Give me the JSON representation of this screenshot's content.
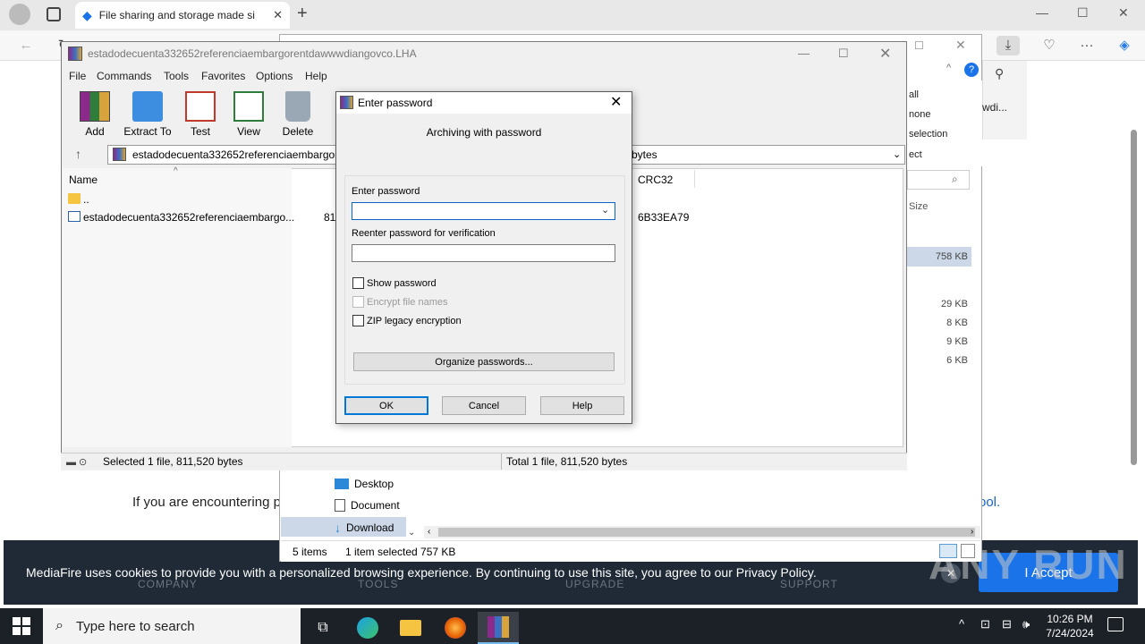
{
  "browser": {
    "tab_title": "File sharing and storage made si",
    "tab_close": "✕",
    "new_tab": "+",
    "min": "—",
    "max": "☐",
    "close": "✕",
    "more": "···"
  },
  "page": {
    "text_partial": "If you are encountering p",
    "link_partial": "ool.",
    "cookie_text": "MediaFire uses cookies to provide you with a personalized browsing experience. By continuing to use this site, you agree to our Privacy Policy.",
    "accept_label": "I Accept",
    "cookie_close": "✕",
    "footer_nav": [
      "COMPANY",
      "TOOLS",
      "UPGRADE",
      "SUPPORT"
    ],
    "watermark": "ANY RUN"
  },
  "explorer": {
    "menu_items": [
      "all",
      "none",
      "selection",
      "ect"
    ],
    "snippet": "wdi...",
    "size_header": "Size",
    "sizes": [
      "758 KB",
      "29 KB",
      "8 KB",
      "9 KB",
      "6 KB"
    ],
    "nav_items": [
      "Desktop",
      "Document",
      "Download"
    ],
    "status_items": "5 items",
    "status_selected": "1 item selected  757 KB"
  },
  "winrar": {
    "title": "estadodecuenta332652referenciaembargorentdawwwdiangovco.LHA",
    "menu": [
      "File",
      "Commands",
      "Tools",
      "Favorites",
      "Options",
      "Help"
    ],
    "tools": [
      "Add",
      "Extract To",
      "Test",
      "View",
      "Delete"
    ],
    "address": "estadodecuenta332652referenciaembargore",
    "address_tail": "bytes",
    "col_name": "Name",
    "col_crc": "CRC32",
    "rows": [
      {
        "name": "..",
        "size": "",
        "crc": ""
      },
      {
        "name": "estadodecuenta332652referenciaembargo...",
        "size": "81",
        "crc": "6B33EA79"
      }
    ],
    "status_left": "Selected 1 file, 811,520 bytes",
    "status_right": "Total 1 file, 811,520 bytes"
  },
  "dialog": {
    "title": "Enter password",
    "subtitle": "Archiving with password",
    "enter_label": "Enter password",
    "enter_value": "",
    "reenter_label": "Reenter password for verification",
    "reenter_value": "",
    "show_password": "Show password",
    "encrypt_names": "Encrypt file names",
    "zip_legacy": "ZIP legacy encryption",
    "organize": "Organize passwords...",
    "ok": "OK",
    "cancel": "Cancel",
    "help": "Help"
  },
  "taskbar": {
    "search_placeholder": "Type here to search",
    "time": "10:26 PM",
    "date": "7/24/2024"
  }
}
